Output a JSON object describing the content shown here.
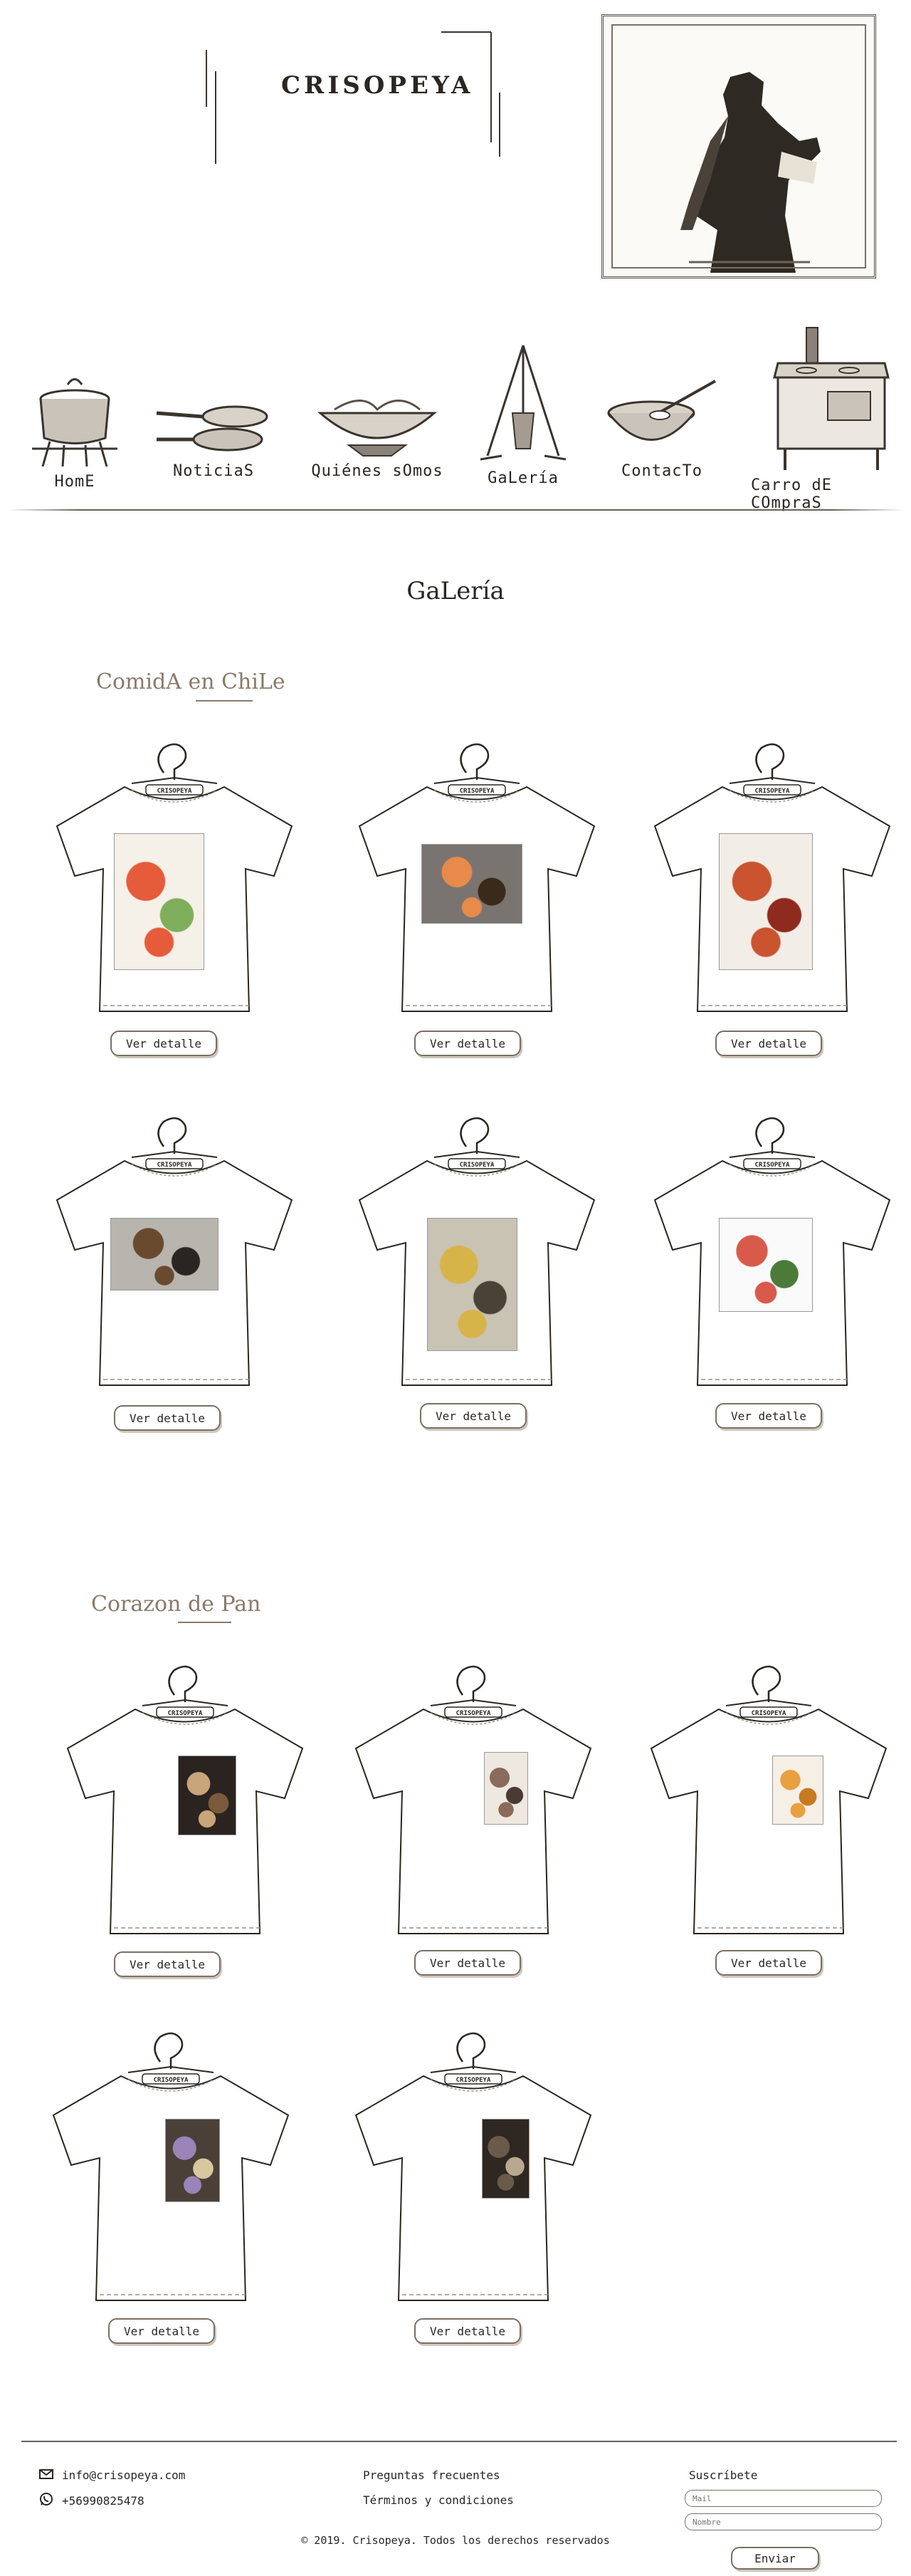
{
  "brand": {
    "name": "CRISOPEYA"
  },
  "nav": [
    {
      "label": "HomE",
      "icon": "pot-on-stove-icon"
    },
    {
      "label": "NoticiaS",
      "icon": "frying-pans-icon"
    },
    {
      "label": "Quiénes sOmos",
      "icon": "wok-with-food-icon"
    },
    {
      "label": "GaLería",
      "icon": "tripod-pot-icon"
    },
    {
      "label": "ContacTo",
      "icon": "mixing-bowl-icon"
    },
    {
      "label": "Carro dE COmpraS",
      "icon": "wood-stove-icon"
    }
  ],
  "page": {
    "title": "GaLería"
  },
  "sections": [
    {
      "title": "ComidA en ChiLe",
      "items": [
        {
          "button": "Ver detalle",
          "shirt_label": "CRISOPEYA",
          "photo_colors": [
            "#f5f0e8",
            "#e65b3a",
            "#7fae5a"
          ]
        },
        {
          "button": "Ver detalle",
          "shirt_label": "CRISOPEYA",
          "photo_colors": [
            "#7a7470",
            "#e88a4a",
            "#3a2a1a"
          ]
        },
        {
          "button": "Ver detalle",
          "shirt_label": "CRISOPEYA",
          "photo_colors": [
            "#f2ede6",
            "#c9542f",
            "#8e2b1e"
          ]
        },
        {
          "button": "Ver detalle",
          "shirt_label": "CRISOPEYA",
          "photo_colors": [
            "#b8b4ae",
            "#6a4a2e",
            "#2a2522"
          ]
        },
        {
          "button": "Ver detalle",
          "shirt_label": "CRISOPEYA",
          "photo_colors": [
            "#c9c3b4",
            "#d7b44a",
            "#4a4236"
          ]
        },
        {
          "button": "Ver detalle",
          "shirt_label": "CRISOPEYA",
          "photo_colors": [
            "#fafafa",
            "#d85a4a",
            "#4b7a3a"
          ]
        }
      ]
    },
    {
      "title": "Corazon de Pan",
      "items": [
        {
          "button": "Ver detalle",
          "shirt_label": "CRISOPEYA",
          "photo_colors": [
            "#2a2320",
            "#c9a57a",
            "#7a5a3a"
          ]
        },
        {
          "button": "Ver detalle",
          "shirt_label": "CRISOPEYA",
          "photo_colors": [
            "#efe8e0",
            "#8a6a5a",
            "#4a3a34"
          ]
        },
        {
          "button": "Ver detalle",
          "shirt_label": "CRISOPEYA",
          "photo_colors": [
            "#f6efe6",
            "#e8a040",
            "#c77a22"
          ]
        },
        {
          "button": "Ver detalle",
          "shirt_label": "CRISOPEYA",
          "photo_colors": [
            "#4a4038",
            "#9a84b8",
            "#d8c8a0"
          ]
        },
        {
          "button": "Ver detalle",
          "shirt_label": "CRISOPEYA",
          "photo_colors": [
            "#2e2722",
            "#6a5a4a",
            "#b8a890"
          ]
        }
      ]
    }
  ],
  "footer": {
    "email": "info@crisopeya.com",
    "phone": "+56990825478",
    "links": [
      "Preguntas frecuentes",
      "Términos y condiciones"
    ],
    "subscribe": {
      "title": "Suscríbete",
      "mail_placeholder": "Mail",
      "name_placeholder": "Nombre",
      "button": "Enviar"
    },
    "copyright": "© 2019. Crisopeya. Todos los derechos reservados"
  },
  "colors": {
    "ink": "#2b2620",
    "muted": "#8a7a6a",
    "line": "#6b6157"
  }
}
